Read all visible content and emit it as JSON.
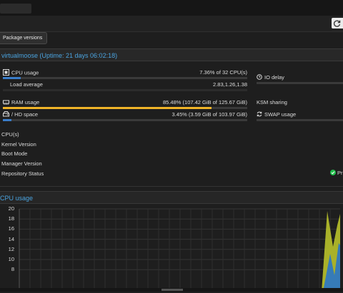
{
  "toolbar": {
    "package_versions_label": "Package versions"
  },
  "node_panel": {
    "title": "virtualmoose (Uptime: 21 days 06:02:18)",
    "metrics": [
      {
        "label": "CPU usage",
        "icon": "cpu-icon",
        "value": "7.36% of 32 CPU(s)",
        "fraction": 0.0736,
        "bar_color": "#3a7dc9"
      },
      {
        "label": "Load average",
        "icon": "none",
        "value": "2.83,1.26,1.38"
      },
      {
        "label": "RAM usage",
        "icon": "memory-icon",
        "value": "85.48% (107.42 GiB of 125.67 GiB)",
        "fraction": 0.8548,
        "bar_color": "#f0b428"
      },
      {
        "label": "/ HD space",
        "icon": "hdd-icon",
        "value": "3.45% (3.59 GiB of 103.97 GiB)",
        "fraction": 0.0345,
        "bar_color": "#3a7dc9"
      }
    ],
    "right_metrics": [
      {
        "label": "IO delay",
        "icon": "clock-icon"
      },
      {
        "label": "KSM sharing",
        "icon": "none"
      },
      {
        "label": "SWAP usage",
        "icon": "swap-icon"
      }
    ],
    "info_rows": [
      "CPU(s)",
      "Kernel Version",
      "Boot Mode",
      "Manager Version",
      "Repository Status"
    ],
    "repository_status_partial": "Pr",
    "repository_status_color": "#21bf4b"
  },
  "cpu_chart_panel": {
    "title": "CPU usage"
  },
  "chart_data": {
    "type": "area",
    "title": "CPU usage",
    "yticks": [
      "20",
      "18",
      "16",
      "14",
      "12",
      "10",
      "8"
    ],
    "ylabel": "",
    "grid": true,
    "colors": {
      "series_a": "#b8c12a",
      "series_b": "#2f78c0"
    }
  },
  "colors": {
    "accent": "#4aa3df",
    "background": "#1e1e1e"
  }
}
